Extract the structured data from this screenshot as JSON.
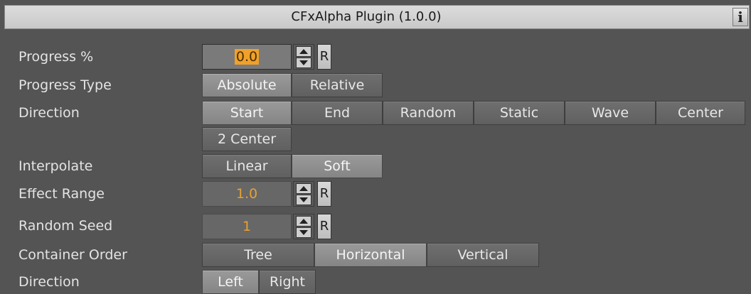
{
  "window": {
    "title": "CFxAlpha Plugin (1.0.0)",
    "info_icon": "i"
  },
  "labels": {
    "progress": "Progress %",
    "progress_type": "Progress Type",
    "direction": "Direction",
    "interpolate": "Interpolate",
    "effect_range": "Effect Range",
    "random_seed": "Random Seed",
    "container_order": "Container Order",
    "direction2": "Direction"
  },
  "progress": {
    "value": "0.0",
    "reset": "R"
  },
  "progress_type": {
    "absolute": "Absolute",
    "relative": "Relative",
    "selected": "Absolute"
  },
  "direction": {
    "start": "Start",
    "end": "End",
    "random": "Random",
    "static": "Static",
    "wave": "Wave",
    "center": "Center",
    "two_center": "2 Center",
    "selected": "Start"
  },
  "interpolate": {
    "linear": "Linear",
    "soft": "Soft",
    "selected": "Soft"
  },
  "effect_range": {
    "value": "1.0",
    "reset": "R"
  },
  "random_seed": {
    "value": "1",
    "reset": "R"
  },
  "container_order": {
    "tree": "Tree",
    "horizontal": "Horizontal",
    "vertical": "Vertical",
    "selected": "Horizontal"
  },
  "direction2": {
    "left": "Left",
    "right": "Right",
    "selected": "Left"
  },
  "colors": {
    "background": "#545454",
    "value_text": "#e8a032",
    "selection": "#f0a12a"
  }
}
